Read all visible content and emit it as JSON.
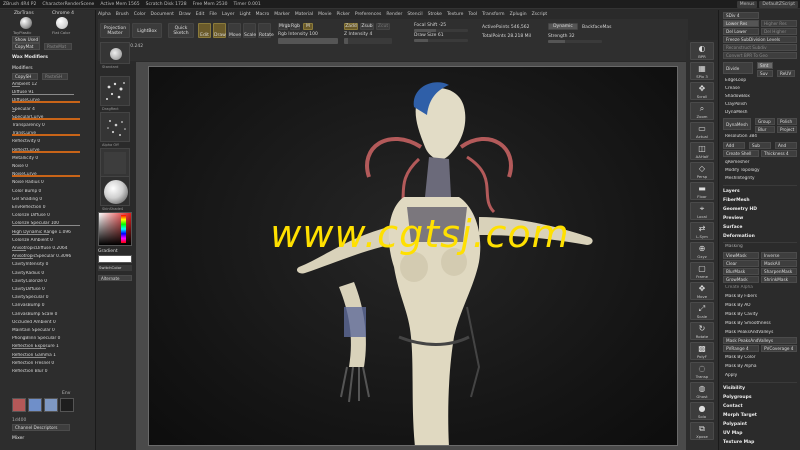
{
  "titlebar": {
    "app": "ZBrush 4R4 P2",
    "doc": "CharacterRenderScene",
    "stats": [
      "Active Mem 1565",
      "Scratch Disk 1728",
      "Free Mem 2530",
      "Timer 0.001"
    ],
    "menu_btn": "Menus",
    "script_btn": "DefaultZScript"
  },
  "menubar": [
    "Alpha",
    "Brush",
    "Color",
    "Document",
    "Draw",
    "Edit",
    "File",
    "Layer",
    "Light",
    "Macro",
    "Marker",
    "Material",
    "Movie",
    "Picker",
    "Preferences",
    "Render",
    "Stencil",
    "Stroke",
    "Texture",
    "Tool",
    "Transform",
    "Zplugin",
    "Zscript"
  ],
  "toolbar": {
    "projection_master": "Projection Master",
    "lightbox": "LightBox",
    "quick_sketch": "Quick Sketch",
    "edit": "Edit",
    "draw": "Draw",
    "move": "Move",
    "scale": "Scale",
    "rotate": "Rotate",
    "mrgb": "Mrgb",
    "rgb": "Rgb",
    "m": "M",
    "zadd": "Zadd",
    "zsub": "Zsub",
    "zcut": "Zcut",
    "focal_shift": "Focal Shift -25",
    "draw_size": "Draw Size 61",
    "rgb_intensity": "Rgb Intensity 100",
    "z_intensity": "Z Intensity 4",
    "active_points": "ActivePoints 546,562",
    "total_points": "TotalPoints 28.218 Mil",
    "dynamic": "Dynamic",
    "backface_mask": "BackfaceMas",
    "strength": "Strength 32",
    "coords": "0.000,-1.519,0.242"
  },
  "left": {
    "top_label_1": "ZbrTrans",
    "top_label_2": "Chrome 4",
    "thumb_label_1": "ToyPlastic",
    "thumb_label_2": "Flat Color",
    "copy_mat": "CopyMat",
    "paste_mat": "PasteMat",
    "show_used": "Show Used",
    "wax_modifiers": "Wax Modifiers",
    "copy_sh": "CopySH",
    "paste_sh": "PasteSH",
    "modifiers": "Modifiers",
    "rows": [
      {
        "label": "Ambient 12",
        "fill": 0.12,
        "style": "plain"
      },
      {
        "label": "Diffuse 91",
        "fill": 0.91,
        "style": "plain"
      },
      {
        "label": "DiffuseCurve",
        "fill": 1.0,
        "style": "orange"
      },
      {
        "label": "Specular 4",
        "fill": 0.04,
        "style": "plain"
      },
      {
        "label": "SpecularCurve",
        "fill": 1.0,
        "style": "orange"
      },
      {
        "label": "Transparency 0",
        "fill": 0.0,
        "style": "plain"
      },
      {
        "label": "TransCurve",
        "fill": 1.0,
        "style": "orange"
      },
      {
        "label": "Reflectivity 0",
        "fill": 0.0,
        "style": "plain"
      },
      {
        "label": "ReflectCurve",
        "fill": 1.0,
        "style": "orange"
      },
      {
        "label": "Metallicity 0",
        "fill": 0.0,
        "style": "plain"
      },
      {
        "label": "Noise 0",
        "fill": 0.0,
        "style": "plain"
      },
      {
        "label": "NoiseCurve",
        "fill": 1.0,
        "style": "orange"
      },
      {
        "label": "Noise Radius 0",
        "fill": 0.0,
        "style": "plain"
      },
      {
        "label": "Color Bump 0",
        "fill": 0.0,
        "style": "plain"
      },
      {
        "label": "Gel Shading 0",
        "fill": 0.0,
        "style": "plain"
      },
      {
        "label": "EnvReflection 0",
        "fill": 0.0,
        "style": "plain"
      },
      {
        "label": "Colorize Diffuse 0",
        "fill": 0.0,
        "style": "plain"
      },
      {
        "label": "Colorize Specular 100",
        "fill": 1.0,
        "style": "plain"
      },
      {
        "label": "High Dynamic Range 1.096",
        "fill": 0.55,
        "style": "plain"
      },
      {
        "label": "Colorize Ambient 0",
        "fill": 0.0,
        "style": "plain"
      },
      {
        "label": "AnisotropicDiffuse 0.2064",
        "fill": 0.2,
        "style": "plain"
      },
      {
        "label": "AnisotropicSpecular 0.3096",
        "fill": 0.31,
        "style": "plain"
      },
      {
        "label": "CavityIntensity 0",
        "fill": 0.0,
        "style": "plain"
      },
      {
        "label": "CavityRadius 0",
        "fill": 0.0,
        "style": "plain"
      },
      {
        "label": "CavityColorize 0",
        "fill": 0.0,
        "style": "plain"
      },
      {
        "label": "CavityDiffuse 0",
        "fill": 0.0,
        "style": "plain"
      },
      {
        "label": "CavitySpecular 0",
        "fill": 0.0,
        "style": "plain"
      },
      {
        "label": "CanvasBump 0",
        "fill": 0.0,
        "style": "plain"
      },
      {
        "label": "CanvasBump Scale 0",
        "fill": 0.0,
        "style": "plain"
      },
      {
        "label": "Occluded Ambient 0",
        "fill": 0.0,
        "style": "plain"
      },
      {
        "label": "Maintain Specular 0",
        "fill": 0.0,
        "style": "plain"
      },
      {
        "label": "PhongBlinn Specular 0",
        "fill": 0.0,
        "style": "plain"
      },
      {
        "label": "Reflection Exposure 1",
        "fill": 0.5,
        "style": "plain"
      },
      {
        "label": "Reflection Gamma 1",
        "fill": 0.5,
        "style": "plain"
      },
      {
        "label": "Reflection Fresnel 0",
        "fill": 0.0,
        "style": "plain"
      },
      {
        "label": "Reflection Blur 0",
        "fill": 0.0,
        "style": "plain"
      }
    ],
    "swatches": [
      "#b45858",
      "#6f8fc9",
      "#7e98c2",
      "#1e1e1e"
    ],
    "swatch_caption": "Env",
    "sub_label": "1d400",
    "channel_descriptors": "Channel Descriptors",
    "mixer": "Mixer"
  },
  "brushcol": {
    "gradient": "Gradient",
    "switch_color": "SwitchColor",
    "alternate": "Alternate",
    "brush_label": "Standard",
    "stroke_label": "DragRect",
    "alpha_label": "Alpha Off",
    "texture_label": "Texture Off",
    "material_label": "SkinShade4"
  },
  "canvas": {
    "watermark": "www.cgtsj.com"
  },
  "rightshelf": [
    {
      "name": "bpr",
      "label": "BPR"
    },
    {
      "name": "spix",
      "label": "SPix 3"
    },
    {
      "name": "scroll",
      "label": "Scroll"
    },
    {
      "name": "zoom",
      "label": "Zoom"
    },
    {
      "name": "actual",
      "label": "Actual"
    },
    {
      "name": "aahalf",
      "label": "AAHalf"
    },
    {
      "name": "persp",
      "label": "Persp"
    },
    {
      "name": "floor",
      "label": "Floor"
    },
    {
      "name": "local",
      "label": "Local"
    },
    {
      "name": "lsym",
      "label": "L.Sym"
    },
    {
      "name": "xyz",
      "label": "Gxyz"
    },
    {
      "name": "frame",
      "label": "Frame"
    },
    {
      "name": "move",
      "label": "Move"
    },
    {
      "name": "scale",
      "label": "Scale"
    },
    {
      "name": "rotate",
      "label": "Rotate"
    },
    {
      "name": "polyf",
      "label": "PolyF"
    },
    {
      "name": "transp",
      "label": "Transp"
    },
    {
      "name": "ghost",
      "label": "Ghost"
    },
    {
      "name": "solo",
      "label": "Solo"
    },
    {
      "name": "xpose",
      "label": "Xpose"
    }
  ],
  "right": {
    "sdiv": "SDiv 4",
    "lower_res": "Lower Res",
    "higher_res": "Higher Res",
    "del_lower": "Del Lower",
    "del_higher": "Del Higher",
    "freeze": "Freeze SubDivision Levels",
    "reconstruct": "Reconstruct Subdiv",
    "convert_bpr": "Convert BPR To Geo",
    "divide": "Divide",
    "smt": "Smt",
    "suv": "Suv",
    "rsmt": "ReUV",
    "edgeloop": "EdgeLoop",
    "crease": "Crease",
    "shadowbox": "ShadowBox",
    "claypolish": "ClayPolish",
    "dynamesh": "DynaMesh",
    "dynamesh2": "DynaMesh",
    "group": "Group",
    "polish": "Polish",
    "blur": "Blur",
    "project": "Project",
    "resolution": "Resolution 384",
    "add": "Add",
    "sub": "Sub",
    "and": "And",
    "create_shell": "Create Shell",
    "thickness": "Thickness 4",
    "qremesher": "qRemesher",
    "modify_topology": "Modify Topology",
    "mesh_integrity": "MeshIntegrity",
    "layers": "Layers",
    "fibermesh": "FiberMesh",
    "geometry_hd": "Geometry HD",
    "preview": "Preview",
    "surface": "Surface",
    "deformation": "Deformation",
    "masking": "Masking",
    "view_mask": "ViewMask",
    "inverse": "Inverse",
    "clear": "Clear",
    "mask_all": "MaskAll",
    "blur_mask": "BlurMask",
    "sharpen_mask": "SharpenMask",
    "grow_mask": "GrowMask",
    "shrink_mask": "ShrinkMask",
    "create_alpha": "Create Alpha",
    "mask_by_fibers": "Mask By Fibers",
    "mask_by_ao": "Mask By AO",
    "mask_by_cavity": "Mask By Cavity",
    "mask_by_smoothness": "Mask By Smoothness",
    "mask_peaks": "Mask PeaksAndValleys",
    "mask_peaks2": "Mask PeaksAndValleys",
    "pvrange": "PVRange 4",
    "pvcoverage": "PVCoverage 4",
    "mask_by_color": "Mask By Color",
    "mask_by_alpha": "Mask By Alpha",
    "apply": "Apply",
    "visibility": "Visibility",
    "polygroups": "Polygroups",
    "contact": "Contact",
    "morph_target": "Morph Target",
    "polypaint": "Polypaint",
    "uv_map": "UV Map",
    "texture_map": "Texture Map"
  }
}
